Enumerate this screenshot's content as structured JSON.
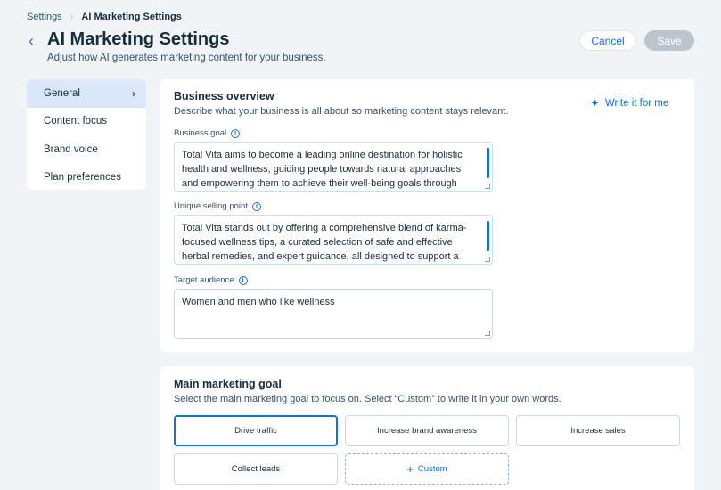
{
  "breadcrumb": {
    "root": "Settings",
    "current": "AI Marketing Settings"
  },
  "header": {
    "title": "AI Marketing Settings",
    "subtitle": "Adjust how AI generates marketing content for your business.",
    "cancel_label": "Cancel",
    "save_label": "Save"
  },
  "sidebar": {
    "items": [
      {
        "label": "General",
        "active": true
      },
      {
        "label": "Content focus"
      },
      {
        "label": "Brand voice"
      },
      {
        "label": "Plan preferences"
      }
    ]
  },
  "business_overview": {
    "title": "Business overview",
    "description": "Describe what your business is all about so marketing content stays relevant.",
    "write_label": "Write it for me",
    "fields": [
      {
        "label": "Business goal",
        "value": "Total Vita aims to become a leading online destination for holistic health and wellness, guiding people towards natural approaches and empowering them to achieve their well-being goals through"
      },
      {
        "label": "Unique selling point",
        "value": "Total Vita stands out by offering a comprehensive blend of karma-focused wellness tips, a curated selection of safe and effective herbal remedies, and expert guidance, all designed to support a"
      },
      {
        "label": "Target audience",
        "value": "Women and men who like wellness"
      }
    ]
  },
  "marketing_goal": {
    "title": "Main marketing goal",
    "description": "Select the main marketing goal to focus on. Select “Custom” to write it in your own words.",
    "options": [
      {
        "label": "Drive traffic",
        "selected": true
      },
      {
        "label": "Increase brand awareness"
      },
      {
        "label": "Increase sales"
      },
      {
        "label": "Collect leads"
      },
      {
        "label": "Custom"
      }
    ]
  },
  "colors": {
    "accent": "#116dff",
    "background": "#f0f4f7",
    "active_nav": "#dbe8fb"
  }
}
